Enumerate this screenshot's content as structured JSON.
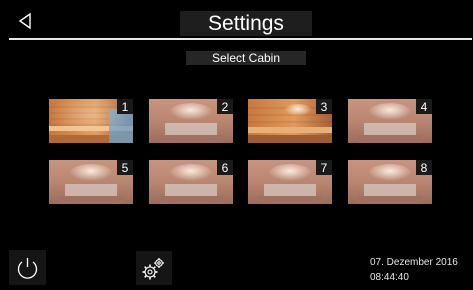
{
  "header": {
    "title": "Settings",
    "back_icon": "back-triangle-icon"
  },
  "subtitle": "Select Cabin",
  "cabins": [
    {
      "number": "1",
      "style": "wood-sauna"
    },
    {
      "number": "2",
      "style": "steam-room"
    },
    {
      "number": "3",
      "style": "wood-sauna"
    },
    {
      "number": "4",
      "style": "steam-room"
    },
    {
      "number": "5",
      "style": "steam-room"
    },
    {
      "number": "6",
      "style": "steam-room"
    },
    {
      "number": "7",
      "style": "steam-room"
    },
    {
      "number": "8",
      "style": "steam-room"
    }
  ],
  "footer": {
    "power_icon": "power-icon",
    "settings_icon": "gears-icon",
    "date": "07. Dezember 2016",
    "time": "08:44:40"
  }
}
